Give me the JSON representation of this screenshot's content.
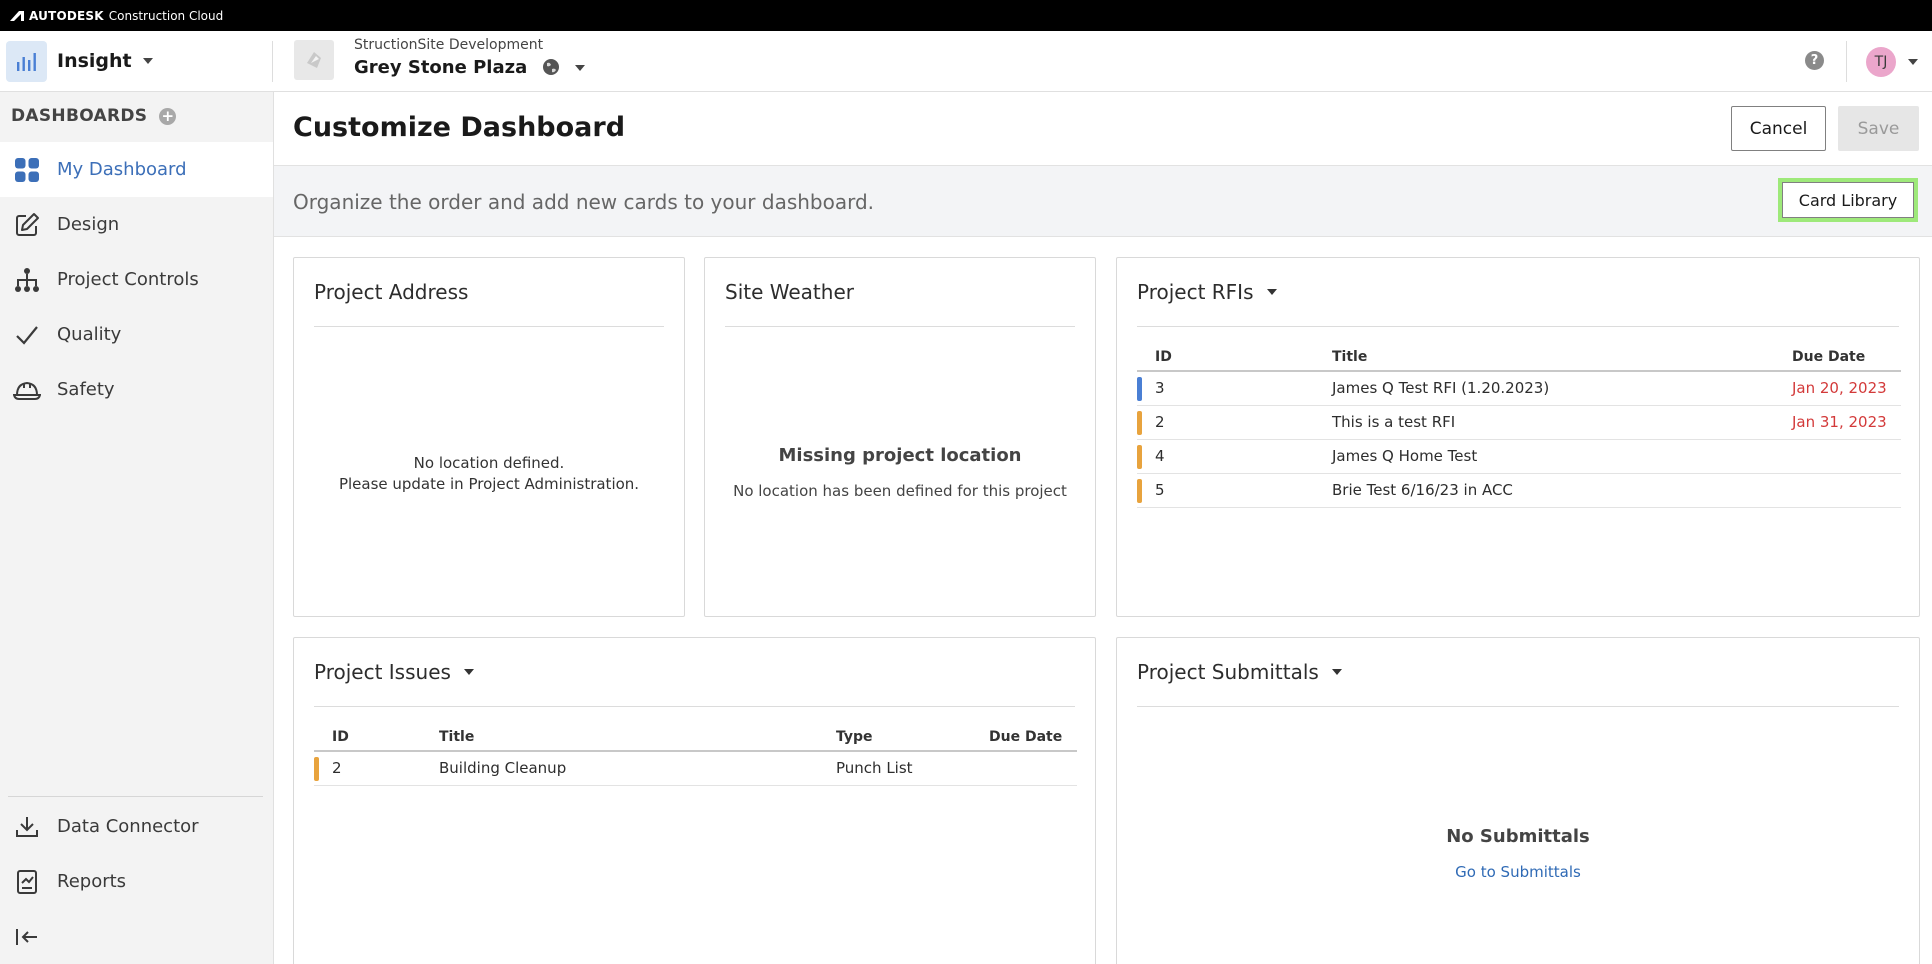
{
  "brand": {
    "name_bold": "AUTODESK",
    "name_rest": "Construction Cloud"
  },
  "header": {
    "module": "Insight",
    "project_account": "StructionSite Development",
    "project_name": "Grey Stone Plaza",
    "help_glyph": "?",
    "user_initials": "TJ"
  },
  "sidebar": {
    "section_label": "DASHBOARDS",
    "add_glyph": "+",
    "items": [
      {
        "label": "My Dashboard",
        "icon": "grid-icon",
        "active": true
      },
      {
        "label": "Design",
        "icon": "pencil-icon"
      },
      {
        "label": "Project Controls",
        "icon": "hierarchy-icon"
      },
      {
        "label": "Quality",
        "icon": "check-icon"
      },
      {
        "label": "Safety",
        "icon": "hardhat-icon"
      }
    ],
    "bottom_items": [
      {
        "label": "Data Connector",
        "icon": "download-icon"
      },
      {
        "label": "Reports",
        "icon": "report-icon"
      }
    ]
  },
  "main": {
    "title": "Customize Dashboard",
    "cancel_label": "Cancel",
    "save_label": "Save",
    "banner_text": "Organize the order and add new cards to your dashboard.",
    "card_library_label": "Card Library"
  },
  "cards": {
    "address": {
      "title": "Project Address",
      "line1": "No location defined.",
      "line2": "Please update in Project Administration."
    },
    "weather": {
      "title": "Site Weather",
      "heading": "Missing project location",
      "text": "No location has been defined for this project"
    },
    "rfis": {
      "title": "Project RFIs",
      "columns": [
        "ID",
        "Title",
        "Due Date"
      ],
      "rows": [
        {
          "id": "3",
          "title": "James Q Test RFI (1.20.2023)",
          "due": "Jan 20, 2023",
          "flag": "#4a7fd4",
          "overdue": true
        },
        {
          "id": "2",
          "title": "This is a test RFI",
          "due": "Jan 31, 2023",
          "flag": "#e8a33d",
          "overdue": true
        },
        {
          "id": "4",
          "title": "James Q Home Test",
          "due": "",
          "flag": "#e8a33d",
          "overdue": false
        },
        {
          "id": "5",
          "title": "Brie Test 6/16/23 in ACC",
          "due": "",
          "flag": "#e8a33d",
          "overdue": false
        }
      ]
    },
    "issues": {
      "title": "Project Issues",
      "columns": [
        "ID",
        "Title",
        "Type",
        "Due Date"
      ],
      "rows": [
        {
          "id": "2",
          "title": "Building Cleanup",
          "type": "Punch List",
          "due": "",
          "flag": "#e8a33d"
        }
      ]
    },
    "submittals": {
      "title": "Project Submittals",
      "heading": "No Submittals",
      "link": "Go to Submittals"
    }
  },
  "colors": {
    "accent": "#3c6fb8",
    "highlight": "#9ee97a",
    "overdue": "#d33a3a",
    "flag_blue": "#4a7fd4",
    "flag_orange": "#e8a33d"
  }
}
